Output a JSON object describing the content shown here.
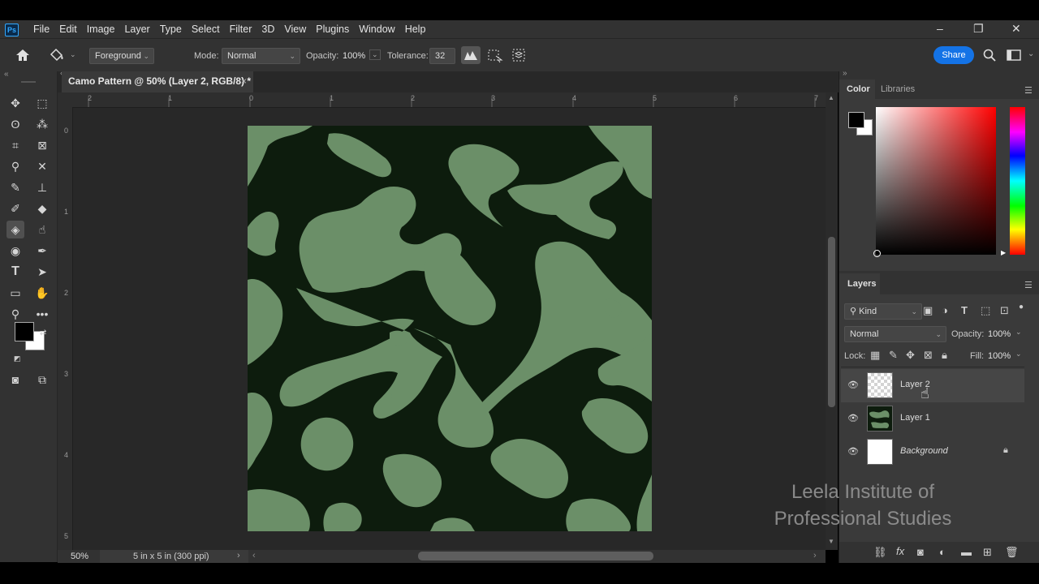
{
  "app": {
    "logo": "Ps"
  },
  "menu": [
    "File",
    "Edit",
    "Image",
    "Layer",
    "Type",
    "Select",
    "Filter",
    "3D",
    "View",
    "Plugins",
    "Window",
    "Help"
  ],
  "window_controls": {
    "minimize": "–",
    "restore": "❐",
    "close": "✕"
  },
  "options": {
    "fill_source": "Foreground",
    "mode_label": "Mode:",
    "mode_value": "Normal",
    "opacity_label": "Opacity:",
    "opacity_value": "100%",
    "tolerance_label": "Tolerance:",
    "tolerance_value": "32",
    "share_label": "Share"
  },
  "document": {
    "tab_title": "Camo Pattern @ 50% (Layer 2, RGB/8) *",
    "close_glyph": "×",
    "zoom": "50%",
    "doc_info": "5 in x 5 in (300 ppi)",
    "ruler_top": [
      "2",
      "1",
      "0",
      "1",
      "2",
      "3",
      "4",
      "5",
      "6",
      "7"
    ],
    "ruler_left": [
      "0",
      "1",
      "2",
      "3",
      "4",
      "5"
    ]
  },
  "colors": {
    "camo_dark": "#0d1c0d",
    "camo_light": "#6b8f68",
    "foreground": "#000000",
    "background": "#ffffff",
    "accent": "#1473e6"
  },
  "color_panel": {
    "tab_color": "Color",
    "tab_libraries": "Libraries"
  },
  "layers_panel": {
    "title": "Layers",
    "filter_kind": "Kind",
    "blend_mode": "Normal",
    "opacity_label": "Opacity:",
    "opacity_value": "100%",
    "lock_label": "Lock:",
    "fill_label": "Fill:",
    "fill_value": "100%",
    "layers": [
      {
        "name": "Layer 2",
        "selected": true
      },
      {
        "name": "Layer 1",
        "selected": false
      },
      {
        "name": "Background",
        "selected": false,
        "locked": true
      }
    ]
  },
  "watermark": {
    "line1": "Leela Institute of",
    "line2": "Professional Studies"
  }
}
